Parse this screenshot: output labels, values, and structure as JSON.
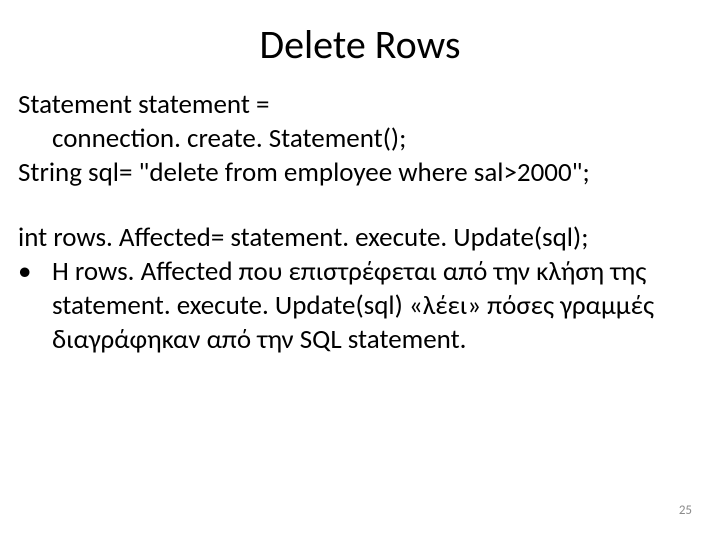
{
  "title": "Delete Rows",
  "code": {
    "l1": "Statement statement =",
    "l2": "connection. create. Statement();",
    "l3": "String  sql= \"delete from employee where sal>2000\";",
    "l4": "int rows. Affected= statement. execute. Update(sql);"
  },
  "bullet": {
    "mark": "•",
    "text": "Η rows. Affected που επιστρέφεται από την κλήση της statement. execute. Update(sql) «λέει» πόσες γραμμές διαγράφηκαν από την SQL statement."
  },
  "page_number": "25"
}
